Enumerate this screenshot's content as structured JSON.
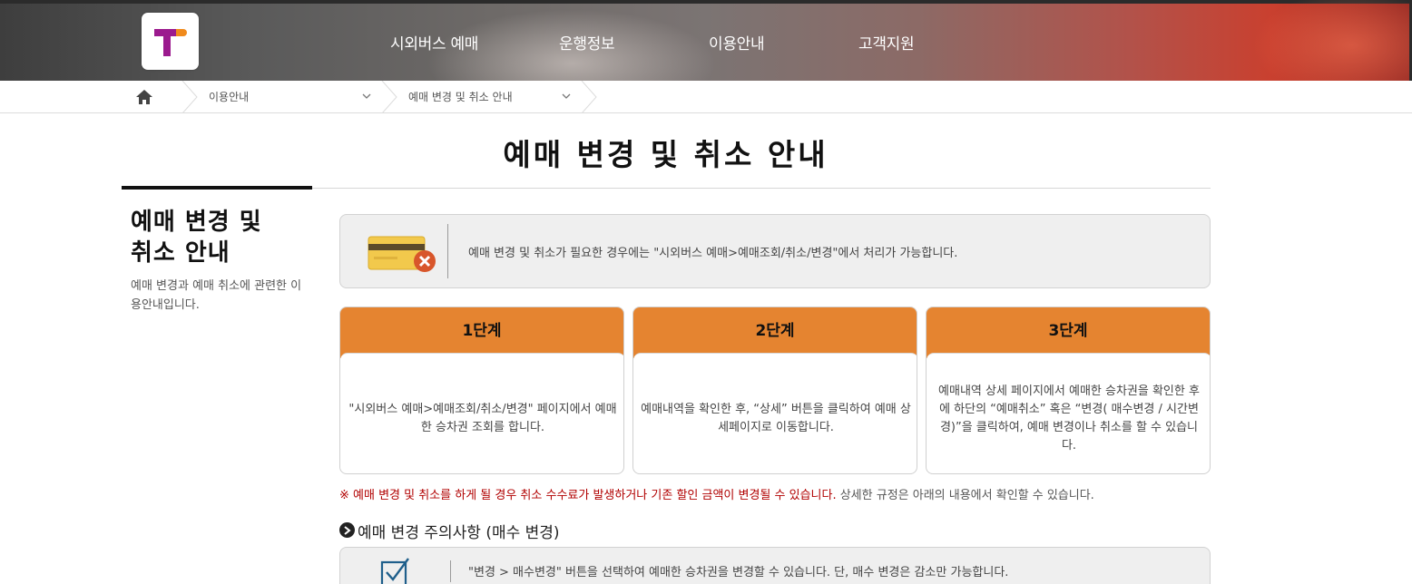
{
  "header": {
    "logo_alt": "T",
    "nav": [
      {
        "label": "시외버스 예매"
      },
      {
        "label": "운행정보"
      },
      {
        "label": "이용안내"
      },
      {
        "label": "고객지원"
      }
    ]
  },
  "breadcrumb": {
    "items": [
      {
        "label": "이용안내"
      },
      {
        "label": "예매 변경 및 취소 안내"
      }
    ]
  },
  "page_title": "예매 변경 및 취소 안내",
  "side": {
    "title_line1": "예매 변경 및",
    "title_line2": "취소 안내",
    "desc": "예매 변경과 예매 취소에 관련한 이용안내입니다."
  },
  "info_box": {
    "text": "예매 변경 및 취소가 필요한 경우에는 \"시외버스 예매>예매조회/취소/변경\"에서 처리가 가능합니다."
  },
  "steps": [
    {
      "title": "1단계",
      "body": "\"시외버스 예매>예매조회/취소/변경\" 페이지에서 예매한 승차권 조회를 합니다."
    },
    {
      "title": "2단계",
      "body": "예매내역을 확인한 후, “상세” 버튼을 클릭하여 예매 상세페이지로 이동합니다."
    },
    {
      "title": "3단계",
      "body": "예매내역 상세 페이지에서 예매한 승차권을 확인한 후에 하단의 “예매취소” 혹은 “변경( 매수변경 / 시간변경)”을 클릭하여, 예매 변경이나 취소를 할 수 있습니다."
    }
  ],
  "notice": {
    "red": "※ 예매 변경 및 취소를 하게 될 경우 취소 수수료가 발생하거나 기존 할인 금액이 변경될 수 있습니다.",
    "gray": " 상세한 규정은 아래의 내용에서 확인할 수 있습니다."
  },
  "section": {
    "title": "예매 변경 주의사항 (매수 변경)",
    "box_text": "\"변경 > 매수변경\" 버튼을 선택하여 예매한 승차권을 변경할 수 있습니다. 단, 매수 변경은 감소만 가능합니다."
  },
  "colors": {
    "accent": "#e58430",
    "notice_red": "#b10000",
    "logo_purple": "#9b1a8e",
    "logo_orange": "#f08a1c"
  }
}
